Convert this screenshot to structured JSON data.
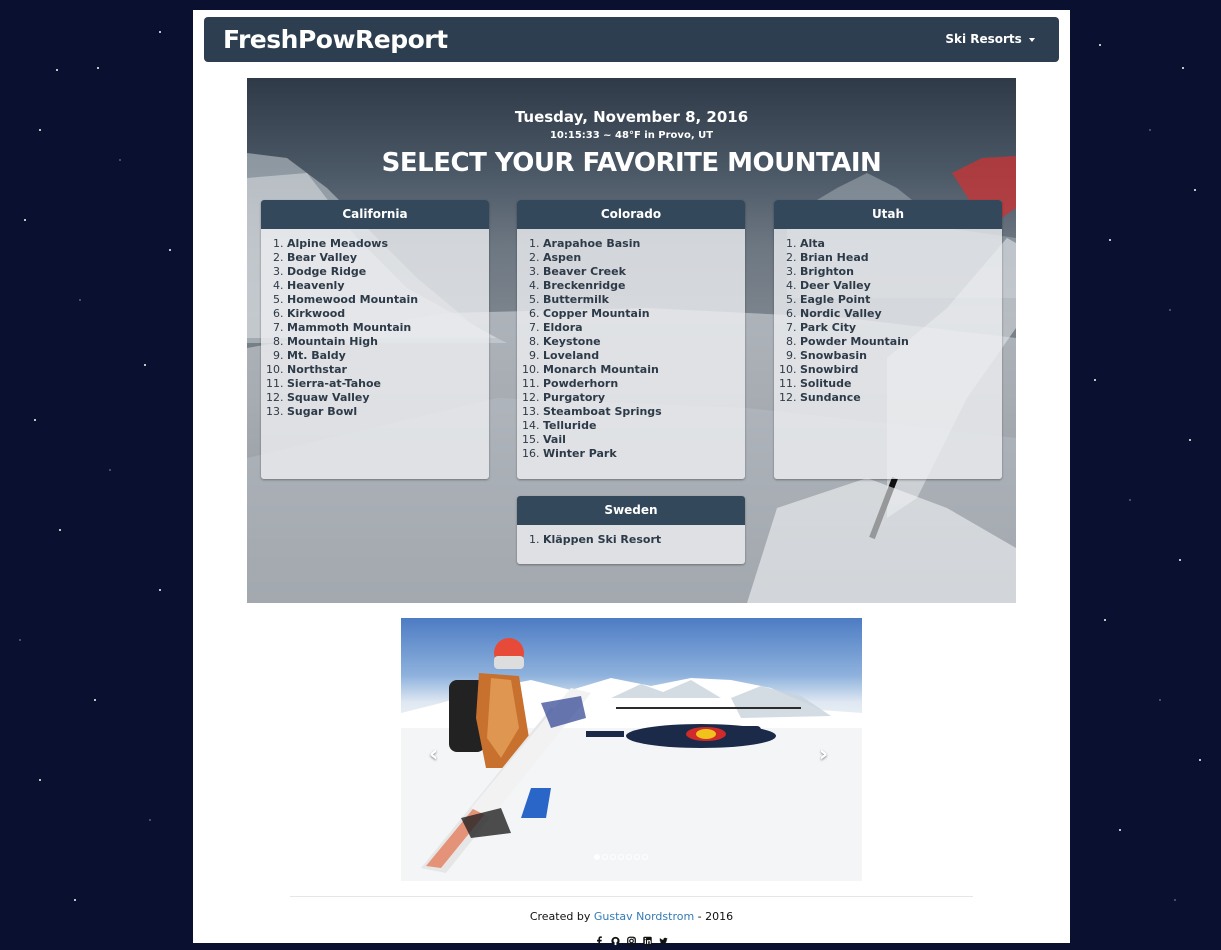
{
  "brand": "FreshPowReport",
  "nav": {
    "menu_label": "Ski Resorts"
  },
  "hero": {
    "date": "Tuesday, November 8, 2016",
    "time_weather": "10:15:33 ~ 48°F in Provo, UT",
    "title": "SELECT YOUR FAVORITE MOUNTAIN"
  },
  "regions": [
    {
      "name": "California",
      "resorts": [
        "Alpine Meadows",
        "Bear Valley",
        "Dodge Ridge",
        "Heavenly",
        "Homewood Mountain",
        "Kirkwood",
        "Mammoth Mountain",
        "Mountain High",
        "Mt. Baldy",
        "Northstar",
        "Sierra-at-Tahoe",
        "Squaw Valley",
        "Sugar Bowl"
      ]
    },
    {
      "name": "Colorado",
      "resorts": [
        "Arapahoe Basin",
        "Aspen",
        "Beaver Creek",
        "Breckenridge",
        "Buttermilk",
        "Copper Mountain",
        "Eldora",
        "Keystone",
        "Loveland",
        "Monarch Mountain",
        "Powderhorn",
        "Purgatory",
        "Steamboat Springs",
        "Telluride",
        "Vail",
        "Winter Park"
      ]
    },
    {
      "name": "Utah",
      "resorts": [
        "Alta",
        "Brian Head",
        "Brighton",
        "Deer Valley",
        "Eagle Point",
        "Nordic Valley",
        "Park City",
        "Powder Mountain",
        "Snowbasin",
        "Snowbird",
        "Solitude",
        "Sundance"
      ]
    },
    {
      "name": "Sweden",
      "resorts": [
        "Kläppen Ski Resort"
      ]
    }
  ],
  "carousel": {
    "prev": "‹",
    "next": "›",
    "slide_count": 7,
    "active_slide": 0
  },
  "footer": {
    "prefix": "Created by ",
    "author": "Gustav Nordstrom",
    "suffix": " - 2016",
    "social_icons": [
      "facebook-icon",
      "github-icon",
      "instagram-icon",
      "linkedin-icon",
      "twitter-icon"
    ]
  }
}
